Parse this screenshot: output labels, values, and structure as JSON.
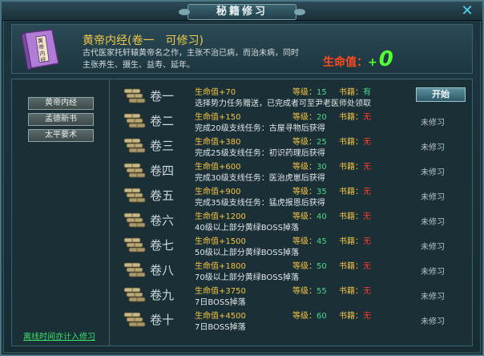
{
  "window": {
    "title": "秘籍修习",
    "close_label": "✕"
  },
  "header": {
    "book_name": "黄帝内经(卷一　可修习)",
    "book_cover_text": "黄帝内经",
    "description": "古代医家托轩辕黄帝名之作，主张不治已病，而治未病，同时主张养生、摄生、益寿、延年。",
    "life_label": "生命值：",
    "life_plus": "+",
    "life_value": "0"
  },
  "sidebar": {
    "items": [
      {
        "label": "黄帝内经"
      },
      {
        "label": "孟德新书"
      },
      {
        "label": "太平要术"
      }
    ],
    "note": "离线时间亦计入修习"
  },
  "rows": [
    {
      "vol": "卷一",
      "life": "生命值+70",
      "level_label": "等级：",
      "level": "15",
      "book_label": "书籍：",
      "book": "有",
      "has_book": true,
      "desc": "选择势力任务赠送，已完成者可至尹老医师处领取",
      "status": "开始"
    },
    {
      "vol": "卷二",
      "life": "生命值+150",
      "level_label": "等级：",
      "level": "20",
      "book_label": "书籍：",
      "book": "无",
      "has_book": false,
      "desc": "完成20级支线任务：古屋寻物后获得",
      "status": "未修习"
    },
    {
      "vol": "卷三",
      "life": "生命值+380",
      "level_label": "等级：",
      "level": "25",
      "book_label": "书籍：",
      "book": "无",
      "has_book": false,
      "desc": "完成25级支线任务：初识药理后获得",
      "status": "未修习"
    },
    {
      "vol": "卷四",
      "life": "生命值+600",
      "level_label": "等级：",
      "level": "30",
      "book_label": "书籍：",
      "book": "无",
      "has_book": false,
      "desc": "完成30级支线任务：医治虎崽后获得",
      "status": "未修习"
    },
    {
      "vol": "卷五",
      "life": "生命值+900",
      "level_label": "等级：",
      "level": "35",
      "book_label": "书籍：",
      "book": "无",
      "has_book": false,
      "desc": "完成35级支线任务：猛虎报恩后获得",
      "status": "未修习"
    },
    {
      "vol": "卷六",
      "life": "生命值+1200",
      "level_label": "等级：",
      "level": "40",
      "book_label": "书籍：",
      "book": "无",
      "has_book": false,
      "desc": "40级以上部分黄绿BOSS掉落",
      "status": "未修习"
    },
    {
      "vol": "卷七",
      "life": "生命值+1500",
      "level_label": "等级：",
      "level": "45",
      "book_label": "书籍：",
      "book": "无",
      "has_book": false,
      "desc": "50级以上部分黄绿BOSS掉落",
      "status": "未修习"
    },
    {
      "vol": "卷八",
      "life": "生命值+1800",
      "level_label": "等级：",
      "level": "50",
      "book_label": "书籍：",
      "book": "无",
      "has_book": false,
      "desc": "70级以上部分黄绿BOSS掉落",
      "status": "未修习"
    },
    {
      "vol": "卷九",
      "life": "生命值+3750",
      "level_label": "等级：",
      "level": "55",
      "book_label": "书籍：",
      "book": "无",
      "has_book": false,
      "desc": "7日BOSS掉落",
      "status": "未修习"
    },
    {
      "vol": "卷十",
      "life": "生命值+4500",
      "level_label": "等级：",
      "level": "60",
      "book_label": "书籍：",
      "book": "无",
      "has_book": false,
      "desc": "7日BOSS掉落",
      "status": "未修习"
    }
  ],
  "colors": {
    "accent_gold": "#f4c443",
    "life_red": "#ff4a1f",
    "life_green": "#55ff33",
    "has_green": "#4cd88b",
    "none_red": "#ff3b2b"
  }
}
